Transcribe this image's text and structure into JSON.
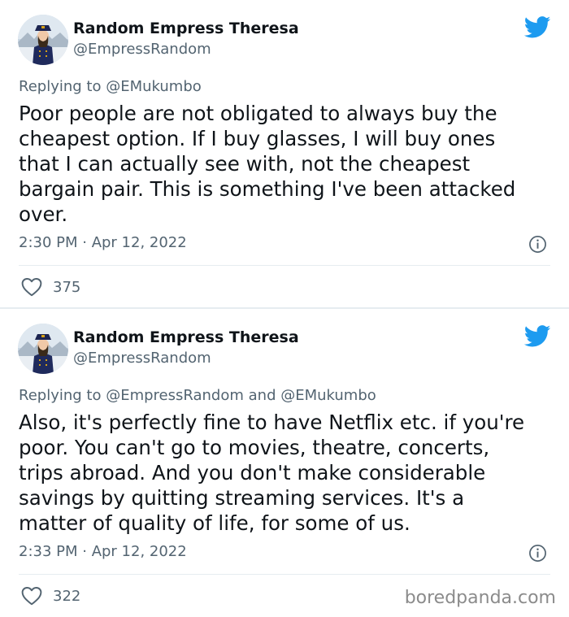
{
  "tweets": [
    {
      "display_name": "Random Empress Theresa",
      "handle": "@EmpressRandom",
      "reply_prefix": "Replying to",
      "reply_mentions": "@EMukumbo",
      "text": "Poor people are not obligated to always buy the\ncheapest option. If I buy glasses, I will buy ones\nthat I can actually see with, not the cheapest\nbargain pair. This is something I've been attacked\nover.",
      "timestamp": "2:30 PM · Apr 12, 2022",
      "likes": "375"
    },
    {
      "display_name": "Random Empress Theresa",
      "handle": "@EmpressRandom",
      "reply_prefix": "Replying to",
      "reply_mentions": "@EmpressRandom and @EMukumbo",
      "text": "Also, it's perfectly fine to have Netflix etc. if you're\npoor. You can't go to movies, theatre, concerts,\ntrips abroad. And you don't make considerable\nsavings by quitting streaming services. It's a\nmatter of quality of life, for some of us.",
      "timestamp": "2:33 PM · Apr 12, 2022",
      "likes": "322"
    }
  ],
  "watermark": "boredpanda.com",
  "colors": {
    "twitter_blue": "#1d9bf0",
    "text": "#0f1419",
    "secondary": "#536471",
    "divider": "#e6ecf0"
  },
  "icons": {
    "brand": "twitter-bird-icon",
    "info": "info-icon",
    "like": "heart-icon"
  }
}
